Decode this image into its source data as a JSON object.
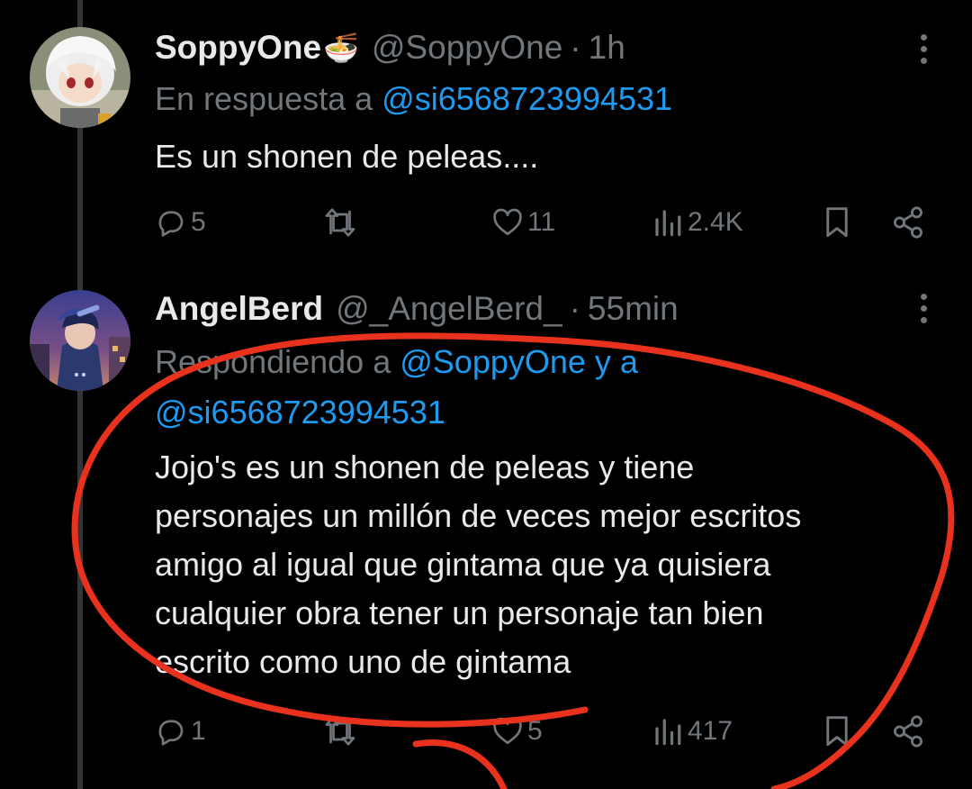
{
  "tweets": [
    {
      "display_name": "SoppyOne",
      "emoji": "🍜",
      "handle": "@SoppyOne",
      "separator": "·",
      "time": "1h",
      "reply_prefix": "En respuesta a",
      "reply_mentions": "@si6568723994531",
      "text": "Es un shonen de peleas....",
      "replies": "5",
      "retweets": "",
      "likes": "11",
      "views": "2.4K"
    },
    {
      "display_name": "AngelBerd",
      "handle": "@_AngelBerd_",
      "separator": "·",
      "time": "55min",
      "reply_prefix": "Respondiendo a",
      "reply_mentions": "@SoppyOne y a @si6568723994531",
      "text_lines": [
        "Jojo's es un shonen de peleas y tiene",
        "personajes un millón de veces mejor escritos",
        "amigo al igual que gintama que ya quisiera",
        "cualquier obra tener un personaje tan bien",
        "escrito como uno de gintama"
      ],
      "replies": "1",
      "retweets": "",
      "likes": "5",
      "views": "417"
    }
  ],
  "colors": {
    "background": "#000000",
    "text": "#e7e9ea",
    "muted": "#71767b",
    "link": "#1d9bf0",
    "annotation": "#e8321e"
  },
  "icons": [
    "reply-icon",
    "retweet-icon",
    "like-icon",
    "views-icon",
    "bookmark-icon",
    "share-icon",
    "more-icon"
  ]
}
